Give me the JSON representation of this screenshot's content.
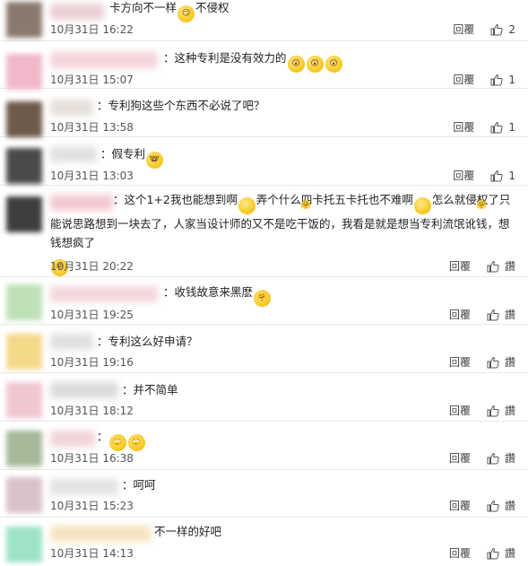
{
  "comments": [
    {
      "text": "卡方向不一样",
      "text2": "不侵权",
      "emojis_inline": [
        "smirk"
      ],
      "time": "10月31日 16:22",
      "reply": "回覆",
      "likes": "2",
      "avatar_color": "#8a7a6e",
      "name_color": "#e9c9cf"
    },
    {
      "text": "：这种专利是没有效力的",
      "emojis": [
        "shock",
        "shock",
        "shock"
      ],
      "time": "10月31日 15:07",
      "reply": "回覆",
      "likes": "1",
      "avatar_color": "#f0b8c8",
      "name_color": "#f2cfd6"
    },
    {
      "text": "：专利狗这些个东西不必说了吧？",
      "time": "10月31日 13:58",
      "reply": "回覆",
      "likes": "1",
      "avatar_color": "#6e5a4a",
      "name_color": "#e3dcd6"
    },
    {
      "text": "：假专利",
      "emojis": [
        "glasses"
      ],
      "time": "10月31日 13:03",
      "reply": "回覆",
      "likes": "1",
      "avatar_color": "#4a4a4a",
      "name_color": "#dedede"
    },
    {
      "text_a": "：这个1+2我也能想到啊",
      "text_b": "弄个什么四卡托五卡托也不难啊",
      "text_c": "怎么就侵权了只能说思路想到一块去了，人家当设计师的又不是吃干饭的，我看是就是想当专利流氓讹钱，想钱想疯了",
      "time": "10月31日 20:22",
      "reply": "回覆",
      "likes": "讚",
      "avatar_color": "#3e3e3e",
      "name_color": "#f0c4cc"
    },
    {
      "text": "：收钱故意来黑麽",
      "emojis": [
        "hug"
      ],
      "time": "10月31日 19:25",
      "reply": "回覆",
      "likes": "讚",
      "avatar_color": "#bfe0b8",
      "name_color": "#f3d2d7"
    },
    {
      "text": "：专利这么好申请？",
      "time": "10月31日 19:16",
      "reply": "回覆",
      "likes": "讚",
      "avatar_color": "#f4d98a",
      "name_color": "#dcdcdc"
    },
    {
      "text": "：并不简单",
      "time": "10月31日 18:12",
      "reply": "回覆",
      "likes": "讚",
      "avatar_color": "#f0c7cf",
      "name_color": "#d8d8d8"
    },
    {
      "text": "：",
      "emojis": [
        "roll",
        "roll"
      ],
      "time": "10月31日 16:38",
      "reply": "回覆",
      "likes": "讚",
      "avatar_color": "#a8b89a",
      "name_color": "#f0cfd5"
    },
    {
      "text": "：呵呵",
      "time": "10月31日 15:23",
      "reply": "回覆",
      "likes": "讚",
      "avatar_color": "#d9c2c8",
      "name_color": "#e0e0e0"
    },
    {
      "text": "不一样的好吧",
      "time": "10月31日 14:13",
      "reply": "回覆",
      "likes": "讚",
      "avatar_color": "#9ee3c8",
      "name_color": "#f5e1b8"
    }
  ],
  "icons": {
    "like": "thumbs-up-icon",
    "emoji": "emoji-icon"
  }
}
